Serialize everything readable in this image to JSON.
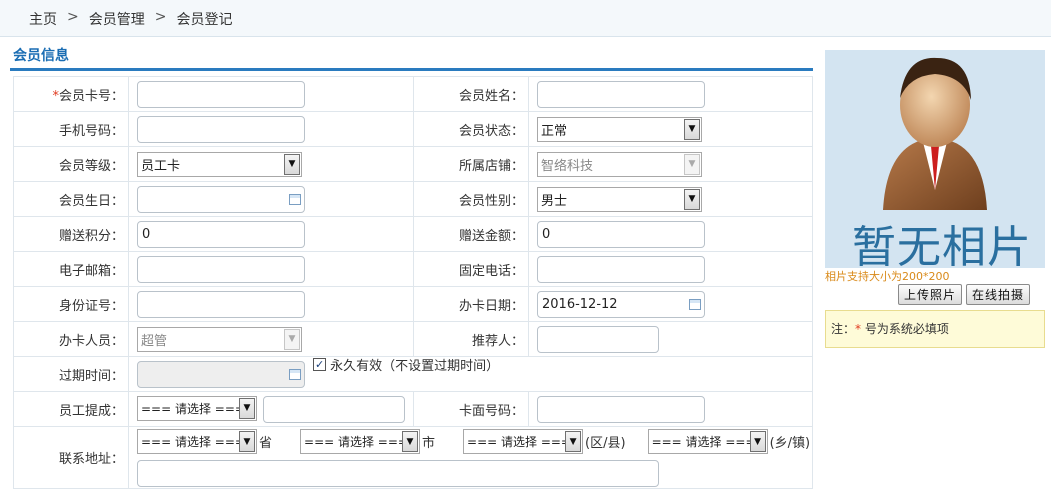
{
  "breadcrumb": {
    "home": "主页",
    "sep": ">",
    "level1": "会员管理",
    "level2": "会员登记"
  },
  "section": {
    "title": "会员信息"
  },
  "form": {
    "card_no_label": "会员卡号：",
    "card_no_required": "*",
    "card_no_value": "",
    "name_label": "会员姓名：",
    "name_value": "",
    "phone_label": "手机号码：",
    "phone_value": "",
    "status_label": "会员状态：",
    "status_value": "正常",
    "level_label": "会员等级：",
    "level_value": "员工卡",
    "store_label": "所属店铺：",
    "store_value": "智络科技",
    "birthday_label": "会员生日：",
    "birthday_value": "",
    "gender_label": "会员性别：",
    "gender_value": "男士",
    "points_label": "赠送积分：",
    "points_value": "0",
    "amount_label": "赠送金额：",
    "amount_value": "0",
    "email_label": "电子邮箱：",
    "email_value": "",
    "tel_label": "固定电话：",
    "tel_value": "",
    "idcard_label": "身份证号：",
    "idcard_value": "",
    "card_date_label": "办卡日期：",
    "card_date_value": "2016-12-12",
    "handler_label": "办卡人员：",
    "handler_value": "超管",
    "referrer_label": "推荐人：",
    "referrer_value": "",
    "expire_label": "过期时间：",
    "expire_value": "",
    "permanent_checked": true,
    "permanent_label": "永久有效（不设置过期时间）",
    "commission_label": "员工提成：",
    "commission_select": "=== 请选择 ===",
    "commission_value": "",
    "face_no_label": "卡面号码：",
    "face_no_value": "",
    "address_label": "联系地址：",
    "address_province_select": "=== 请选择 ===",
    "address_province_unit": "省",
    "address_city_select": "=== 请选择 ===",
    "address_city_unit": "市",
    "address_district_select": "=== 请选择 ===",
    "address_district_unit": "(区/县)",
    "address_town_select": "=== 请选择 ===",
    "address_town_unit": "(乡/镇)",
    "address_detail_value": ""
  },
  "photo": {
    "placeholder_text": "暂无相片",
    "size_hint": "相片支持大小为200*200",
    "upload_button": "上传照片",
    "camera_button": "在线拍摄",
    "note_prefix": "注：",
    "note_star": "*",
    "note_text": " 号为系统必填项"
  },
  "colors": {
    "accent": "#2a7bbf",
    "required": "#e03a1f",
    "hint": "#d98a1a",
    "note_bg": "#fefbd8"
  }
}
